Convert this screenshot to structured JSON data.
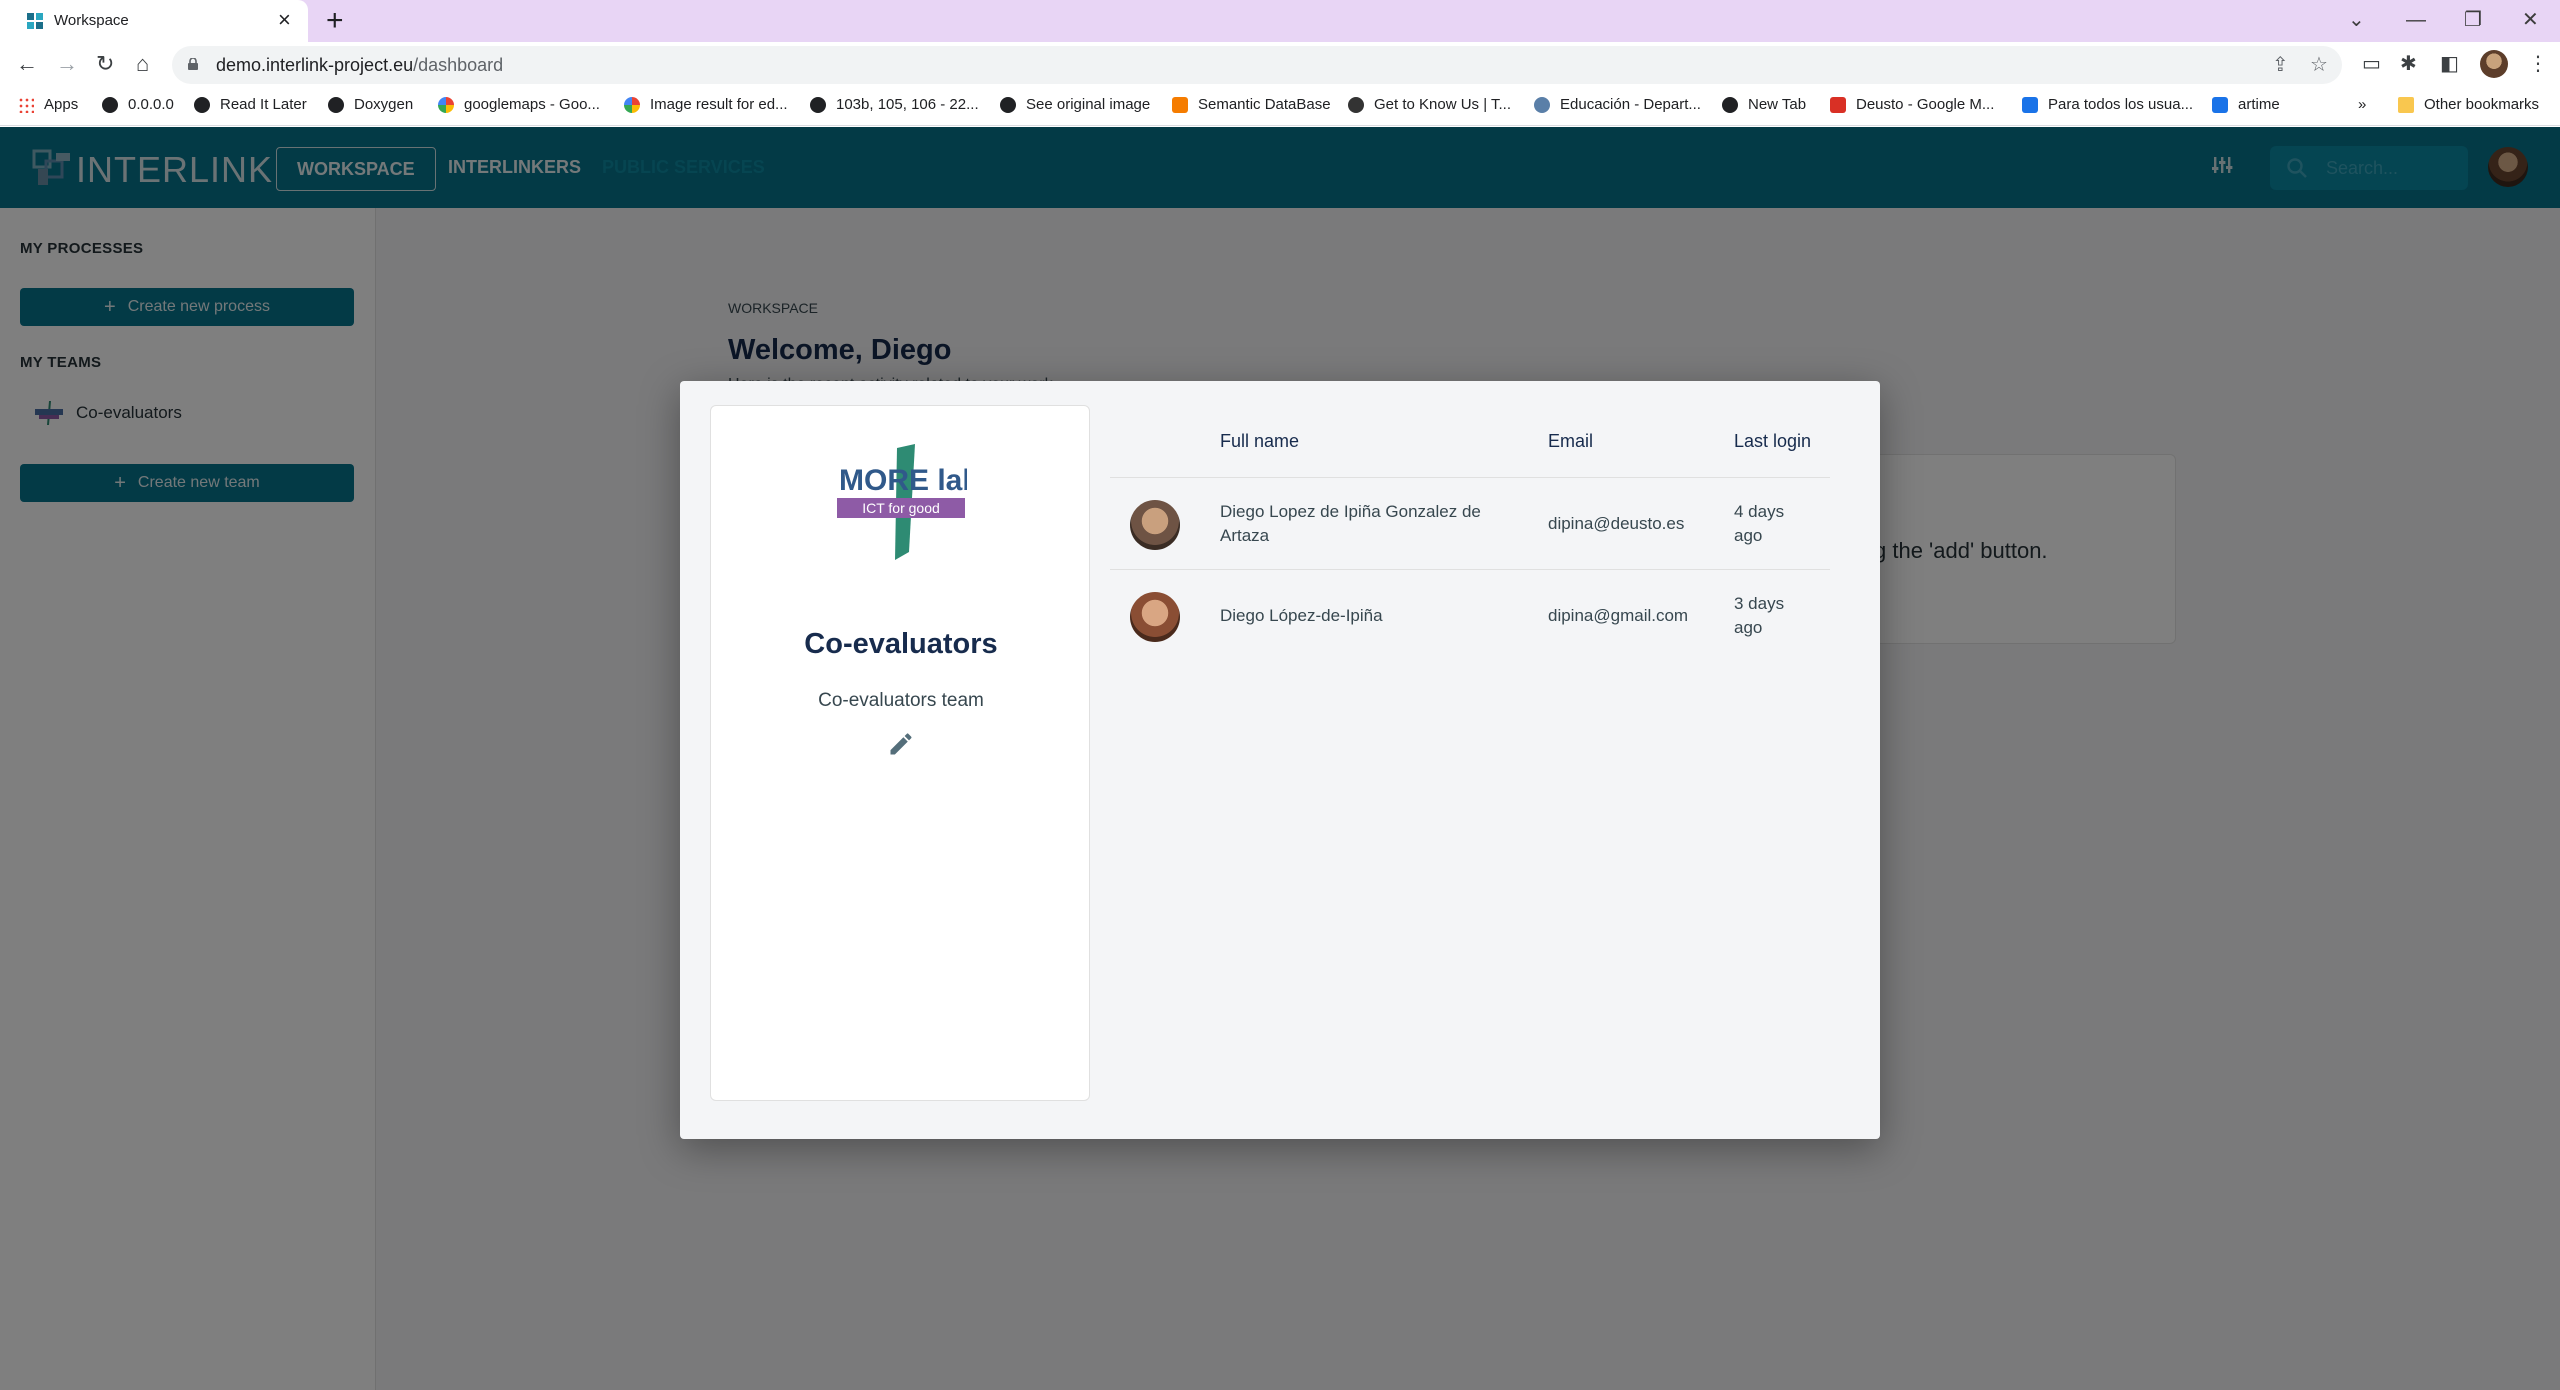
{
  "browser": {
    "tab_title": "Workspace",
    "url_host": "demo.interlink-project.eu",
    "url_path": "/dashboard",
    "bookmarks": [
      "Apps",
      "0.0.0.0",
      "Read It Later",
      "Doxygen",
      "googlemaps - Goo...",
      "Image result for ed...",
      "103b, 105, 106 - 22...",
      "See original image",
      "Semantic DataBase",
      "Get to Know Us | T...",
      "Educación - Depart...",
      "New Tab",
      "Deusto - Google M...",
      "Para todos los usua...",
      "artime"
    ],
    "bookmarks_more": "»",
    "other_bookmarks": "Other bookmarks"
  },
  "app": {
    "logo_text": "INTERLINK",
    "nav": [
      "WORKSPACE",
      "INTERLINKERS",
      "PUBLIC SERVICES"
    ],
    "search_placeholder": "Search...",
    "accent_color": "#06748d"
  },
  "sidebar": {
    "processes_title": "MY PROCESSES",
    "create_process": "Create new process",
    "teams_title": "MY TEAMS",
    "team_item": "Co-evaluators",
    "create_team": "Create new team"
  },
  "main": {
    "breadcrumb": "WORKSPACE",
    "welcome": "Welcome, Diego",
    "subline": "Here is the recent activity related to your work",
    "empty_text": "g the 'add' button."
  },
  "modal": {
    "team_name": "Co-evaluators",
    "team_description": "Co-evaluators team",
    "logo_main": "MORE lab",
    "logo_sub": "ICT for good",
    "columns": [
      "Full name",
      "Email",
      "Last login"
    ],
    "members": [
      {
        "name_line1": "Diego Lopez de Ipiña Gonzalez de",
        "name_line2": "Artaza",
        "email": "dipina@deusto.es",
        "login_line1": "4 days",
        "login_line2": "ago"
      },
      {
        "name_line1": "Diego López-de-Ipiña",
        "name_line2": "",
        "email": "dipina@gmail.com",
        "login_line1": "3 days",
        "login_line2": "ago"
      }
    ]
  }
}
